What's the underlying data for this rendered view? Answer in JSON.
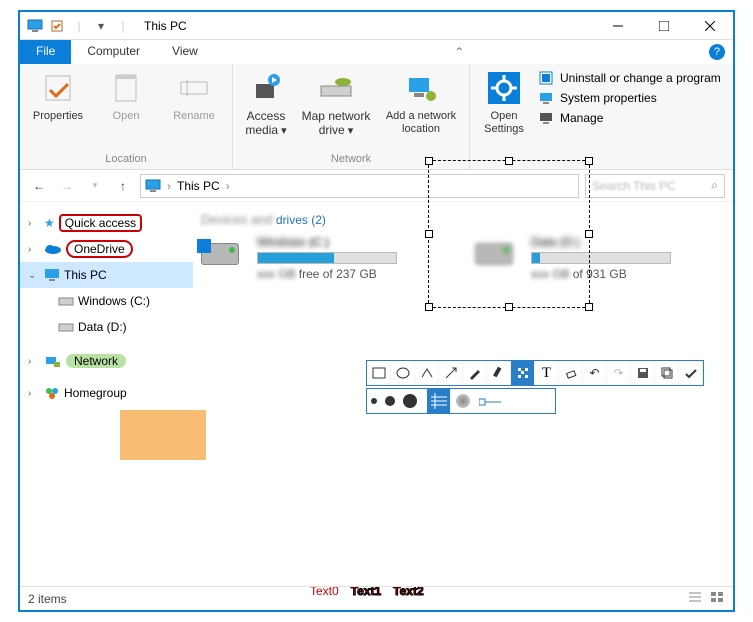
{
  "titlebar": {
    "title": "This PC"
  },
  "tabs": {
    "file": "File",
    "computer": "Computer",
    "view": "View"
  },
  "ribbon": {
    "location": {
      "properties": "Properties",
      "open": "Open",
      "rename": "Rename",
      "group": "Location"
    },
    "network": {
      "access_media": "Access media",
      "map_drive": "Map network drive",
      "add_loc": "Add a network location",
      "group": "Network"
    },
    "system": {
      "open_settings": "Open Settings",
      "uninstall": "Uninstall or change a program",
      "sys_props": "System properties",
      "manage": "Manage"
    }
  },
  "address": {
    "crumb": "This PC",
    "sep": "›"
  },
  "search": {
    "placeholder": "Search This PC"
  },
  "nav": {
    "quick_access": "Quick access",
    "onedrive": "OneDrive",
    "this_pc": "This PC",
    "win_c": "Windows (C:)",
    "data_d": "Data (D:)",
    "network": "Network",
    "homegroup": "Homegroup"
  },
  "content": {
    "section_label_blur": "Devices and",
    "section_label": "drives",
    "section_count": "(2)",
    "drive1": {
      "label_blur": "Windows",
      "label_clear": "(C:)",
      "sub_blur": "xxx GB",
      "sub_clear": "free of 237 GB",
      "fill_pct": 55
    },
    "drive2": {
      "label_blur": "Data (D:)",
      "sub_blur": "xxx GB",
      "sub_clear": "of 931 GB",
      "fill_pct": 6
    }
  },
  "status": {
    "items": "2 items"
  },
  "annotations": {
    "t0": "Text0",
    "t1": "Text1",
    "t2": "Text2"
  },
  "toolbox_icons": [
    "rect",
    "ellipse",
    "line",
    "arrow",
    "pencil",
    "marker",
    "mosaic",
    "text",
    "eraser",
    "undo",
    "redo",
    "save",
    "copy",
    "ok"
  ],
  "subtool_dots": [
    6,
    10,
    14
  ]
}
